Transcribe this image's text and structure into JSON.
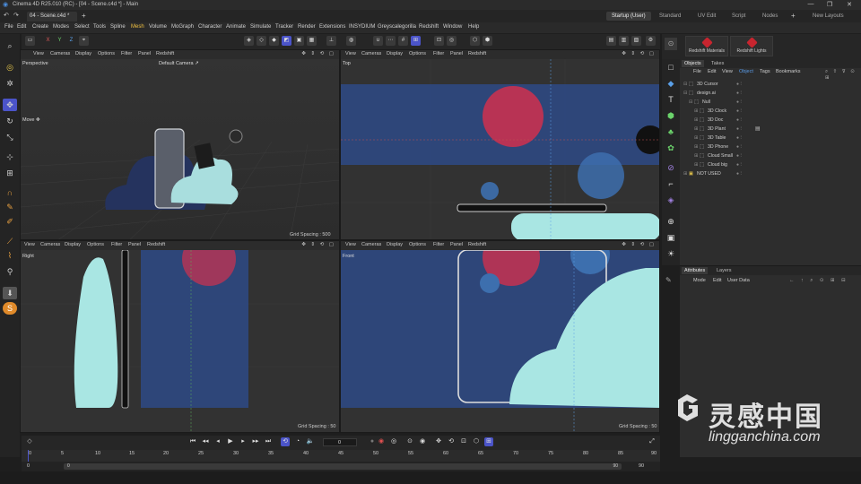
{
  "window": {
    "title": "Cinema 4D R25.010 (RC) - [04 - Scene.c4d *] - Main",
    "controls": [
      "—",
      "❐",
      "✕"
    ]
  },
  "tabs": {
    "document": "04 - Scene.c4d *",
    "add": "+",
    "layouts": [
      "Startup (User)",
      "Standard",
      "UV Edit",
      "Script",
      "Nodes"
    ],
    "layouts_add": "+",
    "new_layouts": "New Layouts"
  },
  "menu": [
    "File",
    "Edit",
    "Create",
    "Modes",
    "Select",
    "Tools",
    "Spline",
    "Mesh",
    "Volume",
    "MoGraph",
    "Character",
    "Animate",
    "Simulate",
    "Tracker",
    "Render",
    "Extensions",
    "INSYDIUM",
    "Greyscalegorilla",
    "Redshift",
    "Window",
    "Help"
  ],
  "toolbar": {
    "axis_labels": [
      "X",
      "Y",
      "Z"
    ]
  },
  "viewports": {
    "menu_items": [
      "View",
      "Cameras",
      "Display",
      "Options",
      "Filter",
      "Panel",
      "Redshift"
    ],
    "perspective": {
      "name": "Perspective",
      "camera": "Default Camera ↗",
      "tool": "Move ✥",
      "grid": "Grid Spacing : 500"
    },
    "top": {
      "name": "Top"
    },
    "right": {
      "name": "Right",
      "grid": "Grid Spacing : 50"
    },
    "front": {
      "name": "Front",
      "grid": "Grid Spacing : 50"
    }
  },
  "redshift_buttons": [
    "Redshift Materials",
    "Redshift Lights"
  ],
  "objects_panel": {
    "tabs": [
      "Objects",
      "Takes"
    ],
    "menu": [
      "File",
      "Edit",
      "View",
      "Object",
      "Tags",
      "Bookmarks"
    ],
    "active_menu": "Object",
    "tree": [
      {
        "label": "3D Cursor",
        "depth": 0
      },
      {
        "label": "design.ai",
        "depth": 0
      },
      {
        "label": "Null",
        "depth": 1
      },
      {
        "label": "3D Clock",
        "depth": 2
      },
      {
        "label": "3D Doc",
        "depth": 2
      },
      {
        "label": "3D Plant",
        "depth": 2
      },
      {
        "label": "3D Table",
        "depth": 2
      },
      {
        "label": "3D Phone",
        "depth": 2
      },
      {
        "label": "Cloud Small",
        "depth": 2
      },
      {
        "label": "Cloud big",
        "depth": 2
      },
      {
        "label": "NOT USED",
        "depth": 0
      }
    ]
  },
  "attributes_panel": {
    "tabs": [
      "Attributes",
      "Layers"
    ],
    "menu": [
      "Mode",
      "Edit",
      "User Data"
    ]
  },
  "timeline": {
    "current_frame": "0",
    "ruler_ticks": [
      "0",
      "5",
      "10",
      "15",
      "20",
      "25",
      "30",
      "35",
      "40",
      "45",
      "50",
      "55",
      "60",
      "65",
      "70",
      "75",
      "80",
      "85",
      "90"
    ],
    "range_start": "0",
    "range_start2": "0",
    "range_end": "90",
    "range_end2": "90"
  },
  "watermark": {
    "cn": "灵感中国",
    "en": "lingganchina.com"
  },
  "colors": {
    "accent": "#4b54c9",
    "redshift_red": "#c8252f",
    "mesh_blue": "#2e4a86",
    "mesh_cyan": "#a9e6e3",
    "mesh_red": "#d0304e"
  }
}
